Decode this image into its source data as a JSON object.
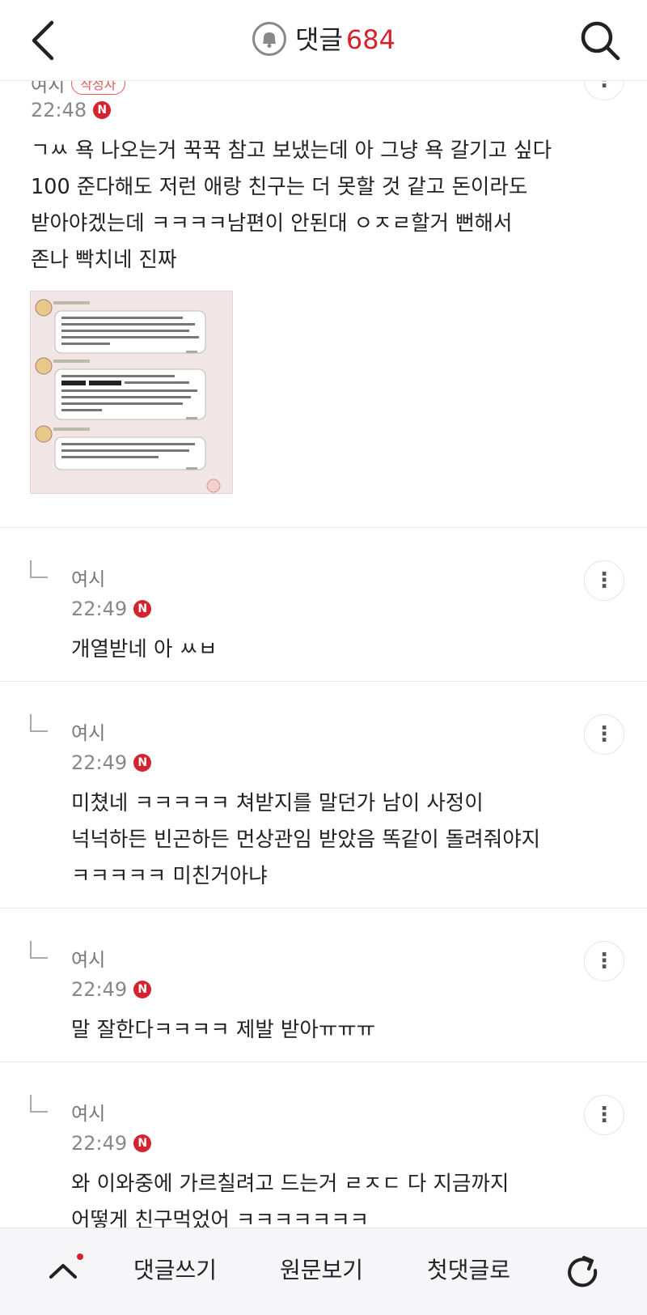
{
  "header": {
    "title": "댓글",
    "count": "684"
  },
  "comments": [
    {
      "author": "여시",
      "badge": "작성자",
      "time": "22:48",
      "new_badge": "N",
      "text": "ㄱㅆ 욕 나오는거 꾹꾹 참고 보냈는데 아 그냥 욕 갈기고 싶다\n100 준다해도 저런 애랑 친구는 더 못할 것 같고 돈이라도\n받아야겠는데 ㅋㅋㅋㅋ남편이 안된대 ㅇㅈㄹ할거 뻔해서\n존나 빡치네 진짜"
    },
    {
      "author": "여시",
      "time": "22:49",
      "new_badge": "N",
      "text": "개열받네 아 ㅆㅂ"
    },
    {
      "author": "여시",
      "time": "22:49",
      "new_badge": "N",
      "text": "미쳤네 ㅋㅋㅋㅋㅋ 쳐받지를 말던가 남이 사정이\n넉넉하든 빈곤하든 먼상관임 받았음 똑같이 돌려줘야지\nㅋㅋㅋㅋㅋ 미친거아냐"
    },
    {
      "author": "여시",
      "time": "22:49",
      "new_badge": "N",
      "text": "말 잘한다ㅋㅋㅋㅋ 제발 받아ㅠㅠㅠ"
    },
    {
      "author": "여시",
      "time": "22:49",
      "new_badge": "N",
      "text": "와 이와중에 가르칠려고 드는거 ㄹㅈㄷ 다 지금까지\n어떻게 친구먹었어 ㅋㅋㅋㅋㅋㅋㅋ"
    }
  ],
  "bottom_bar": {
    "write_comment": "댓글쓰기",
    "view_original": "원문보기",
    "first_comment": "첫댓글로"
  },
  "colors": {
    "accent": "#d3232f",
    "muted_text": "#888888"
  },
  "icons": [
    "back-arrow-icon",
    "bell-icon",
    "search-icon",
    "more-vertical-icon",
    "reply-indent-icon",
    "chevron-up-icon",
    "refresh-icon"
  ]
}
